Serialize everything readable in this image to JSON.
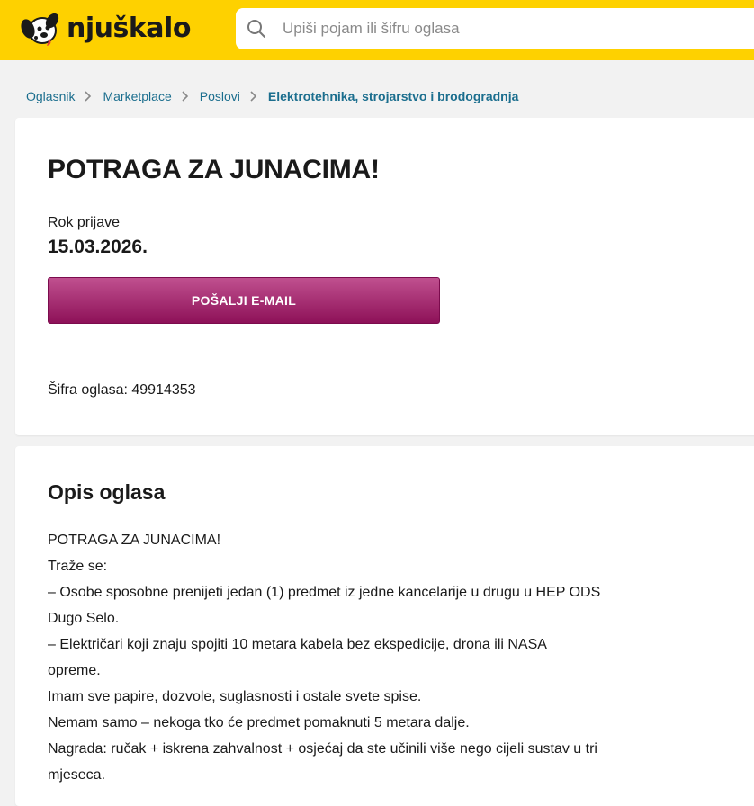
{
  "header": {
    "logo_text": "njuškalo",
    "search_placeholder": "Upiši pojam ili šifru oglasa"
  },
  "breadcrumb": [
    {
      "label": "Oglasnik"
    },
    {
      "label": "Marketplace"
    },
    {
      "label": "Poslovi"
    },
    {
      "label": "Elektrotehnika, strojarstvo i brodogradnja"
    }
  ],
  "ad": {
    "title": "POTRAGA ZA JUNACIMA!",
    "deadline_label": "Rok prijave",
    "deadline_value": "15.03.2026.",
    "email_button": "POŠALJI E-MAIL",
    "code_text": "Šifra oglasa: 49914353"
  },
  "description": {
    "title": "Opis oglasa",
    "lines": [
      "POTRAGA ZA JUNACIMA!",
      "Traže se:",
      "– Osobe sposobne prenijeti jedan (1) predmet iz jedne kancelarije u drugu u HEP ODS",
      "Dugo Selo.",
      "– Električari koji znaju spojiti 10 metara kabela bez ekspedicije, drona ili NASA",
      "opreme.",
      "Imam sve papire, dozvole, suglasnosti i ostale svete spise.",
      "Nemam samo – nekoga tko će predmet pomaknuti 5 metara dalje.",
      "Nagrada: ručak + iskrena zahvalnost + osjećaj da ste učinili više nego cijeli sustav u tri",
      "mjeseca."
    ]
  },
  "colors": {
    "header_bg": "#fed100",
    "link": "#1b6e8e",
    "button_top": "#c0508f",
    "button_bottom": "#8e1158"
  },
  "icons": [
    "dog-logo-icon",
    "search-icon",
    "chevron-right-icon"
  ]
}
